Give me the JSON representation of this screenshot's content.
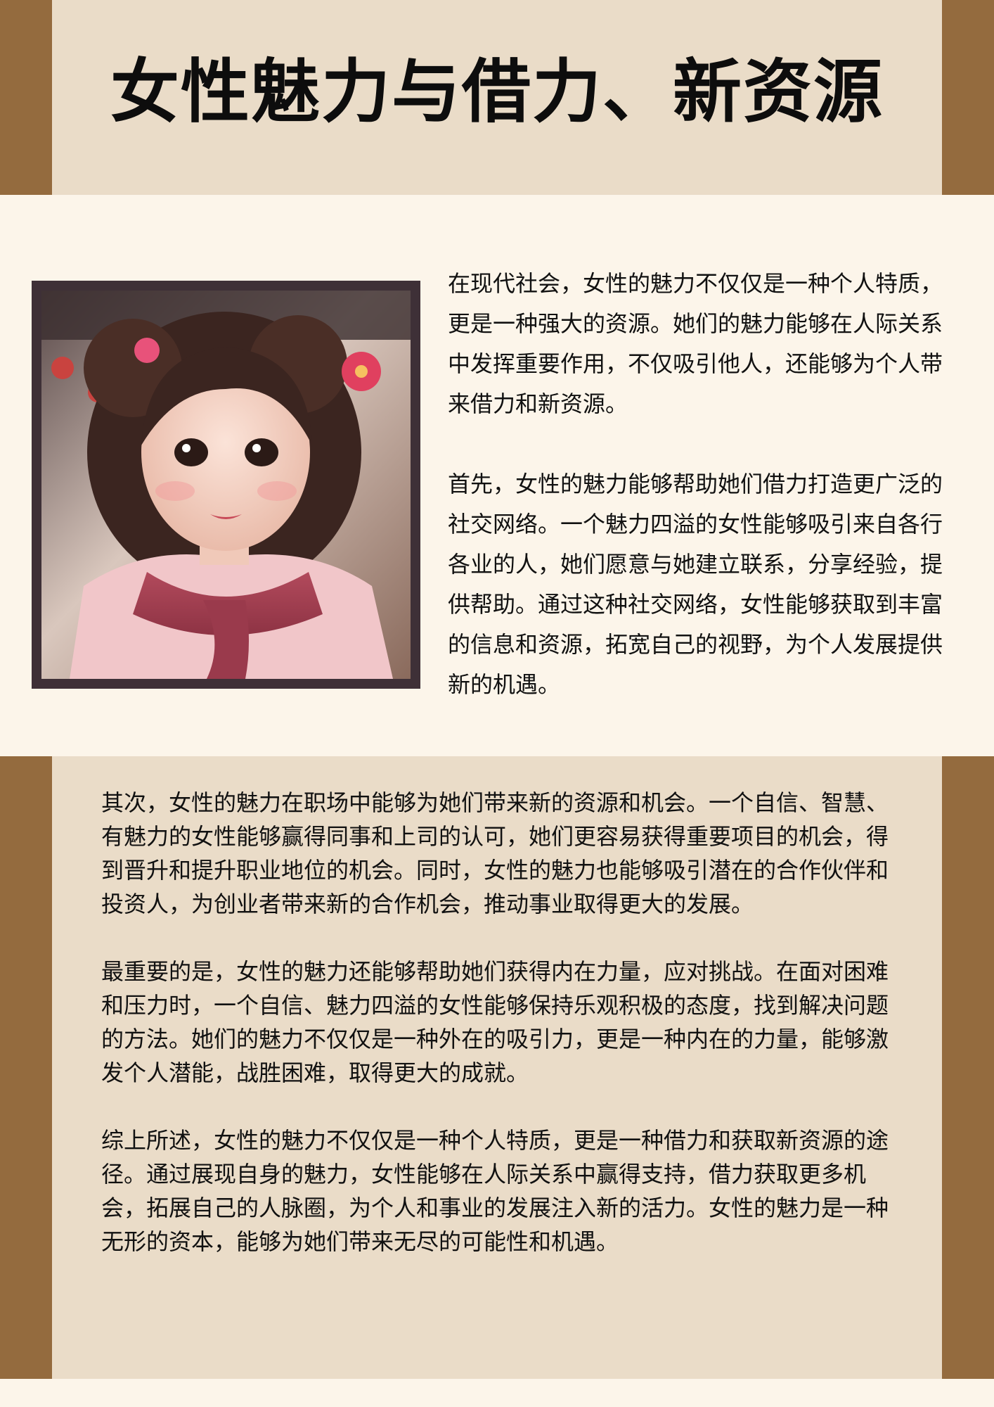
{
  "title": "女性魅力与借力、新资源",
  "colors": {
    "frame_brown": "#946b3e",
    "panel_beige": "#eadcc8",
    "page_cream": "#fcf5ea",
    "photo_border": "#3e3037"
  },
  "image": {
    "subject_icon": "portrait-image"
  },
  "paragraphs": [
    "在现代社会，女性的魅力不仅仅是一种个人特质，更是一种强大的资源。她们的魅力能够在人际关系中发挥重要作用，不仅吸引他人，还能够为个人带来借力和新资源。",
    "首先，女性的魅力能够帮助她们借力打造更广泛的社交网络。一个魅力四溢的女性能够吸引来自各行各业的人，她们愿意与她建立联系，分享经验，提供帮助。通过这种社交网络，女性能够获取到丰富的信息和资源，拓宽自己的视野，为个人发展提供新的机遇。",
    "其次，女性的魅力在职场中能够为她们带来新的资源和机会。一个自信、智慧、有魅力的女性能够赢得同事和上司的认可，她们更容易获得重要项目的机会，得到晋升和提升职业地位的机会。同时，女性的魅力也能够吸引潜在的合作伙伴和投资人，为创业者带来新的合作机会，推动事业取得更大的发展。",
    "最重要的是，女性的魅力还能够帮助她们获得内在力量，应对挑战。在面对困难和压力时，一个自信、魅力四溢的女性能够保持乐观积极的态度，找到解决问题的方法。她们的魅力不仅仅是一种外在的吸引力，更是一种内在的力量，能够激发个人潜能，战胜困难，取得更大的成就。",
    "综上所述，女性的魅力不仅仅是一种个人特质，更是一种借力和获取新资源的途径。通过展现自身的魅力，女性能够在人际关系中赢得支持，借力获取更多机会，拓展自己的人脉圈，为个人和事业的发展注入新的活力。女性的魅力是一种无形的资本，能够为她们带来无尽的可能性和机遇。"
  ]
}
